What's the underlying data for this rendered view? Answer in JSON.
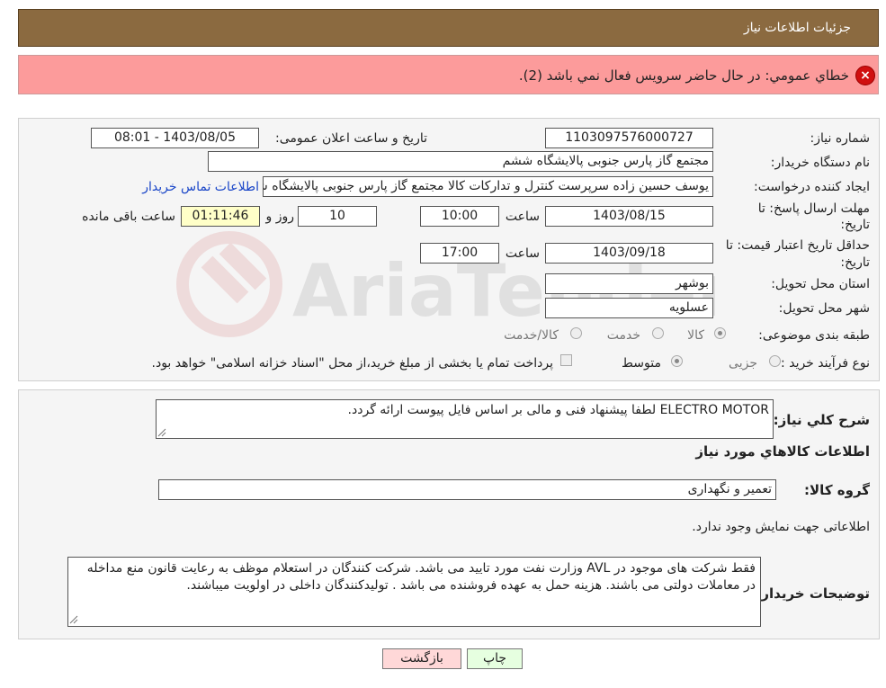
{
  "header": {
    "title": "جزئیات اطلاعات نیاز"
  },
  "error": {
    "icon": "error-x-icon",
    "message": "خطاي عمومي: در حال حاضر سرويس فعال نمي باشد (2)."
  },
  "form": {
    "need_number_label": "شماره نیاز:",
    "need_number": "1103097576000727",
    "announce_label": "تاریخ و ساعت اعلان عمومی:",
    "announce_value": "1403/08/05 - 08:01",
    "buyer_org_label": "نام دستگاه خریدار:",
    "buyer_org": "مجتمع گاز پارس جنوبی  پالایشگاه ششم",
    "creator_label": "ایجاد کننده درخواست:",
    "creator": "یوسف حسین زاده سرپرست کنترل و تدارکات کالا مجتمع گاز پارس جنوبی  پالایشگاه ششم",
    "contact_link": "اطلاعات تماس خریدار",
    "deadline_label_1": "مهلت ارسال پاسخ: تا",
    "deadline_label_2": "تاریخ:",
    "deadline_date": "1403/08/15",
    "hour_label": "ساعت",
    "deadline_time": "10:00",
    "days_value": "10",
    "days_label": "روز و",
    "remaining_time": "01:11:46",
    "remaining_label": "ساعت باقی مانده",
    "validity_label_1": "حداقل تاریخ اعتبار قیمت: تا",
    "validity_label_2": "تاریخ:",
    "validity_date": "1403/09/18",
    "validity_hour_label": "ساعت",
    "validity_time": "17:00",
    "province_label": "استان محل تحویل:",
    "province": "بوشهر",
    "city_label": "شهر محل تحویل:",
    "city": "عسلویه",
    "category_label": "طبقه بندی موضوعی:",
    "category_options": [
      "کالا",
      "خدمت",
      "کالا/خدمت"
    ],
    "category_selected": "کالا",
    "process_label": "نوع فرآیند خرید :",
    "process_options": [
      "جزیی",
      "متوسط"
    ],
    "process_selected": "متوسط",
    "payment_note": "پرداخت تمام یا بخشی از مبلغ خرید،از محل \"اسناد خزانه اسلامی\" خواهد بود."
  },
  "details": {
    "summary_label": "شرح کلي نياز:",
    "summary": "ELECTRO MOTOR لطفا پیشنهاد فنی و مالی بر اساس فایل پیوست ارائه گردد.",
    "goods_heading": "اطلاعات کالاهاي مورد نياز",
    "goods_group_label": "گروه کالا:",
    "goods_group": "تعمیر و نگهداری",
    "no_info": "اطلاعاتی جهت نمایش وجود ندارد.",
    "buyer_notes_label": "توضیحات خریدار:",
    "buyer_notes": "فقط شرکت های موجود در AVL وزارت نفت مورد تایید می باشد. شرکت کنندگان در استعلام موظف به رعایت قانون منع مداخله در معاملات دولتی می باشند. هزینه حمل به عهده فروشنده می باشد . تولیدکنندگان داخلی در اولویت میباشند."
  },
  "buttons": {
    "print": "چاپ",
    "back": "بازگشت"
  },
  "watermark": {
    "text": "AriaTender.neT",
    "icon": "gavel-logo-icon"
  },
  "colors": {
    "header_bg": "#8b6a40",
    "error_bg": "#fc9b9b",
    "print_btn": "#e6ffe0",
    "back_btn": "#ffd8d8",
    "link": "#1a46c8"
  }
}
